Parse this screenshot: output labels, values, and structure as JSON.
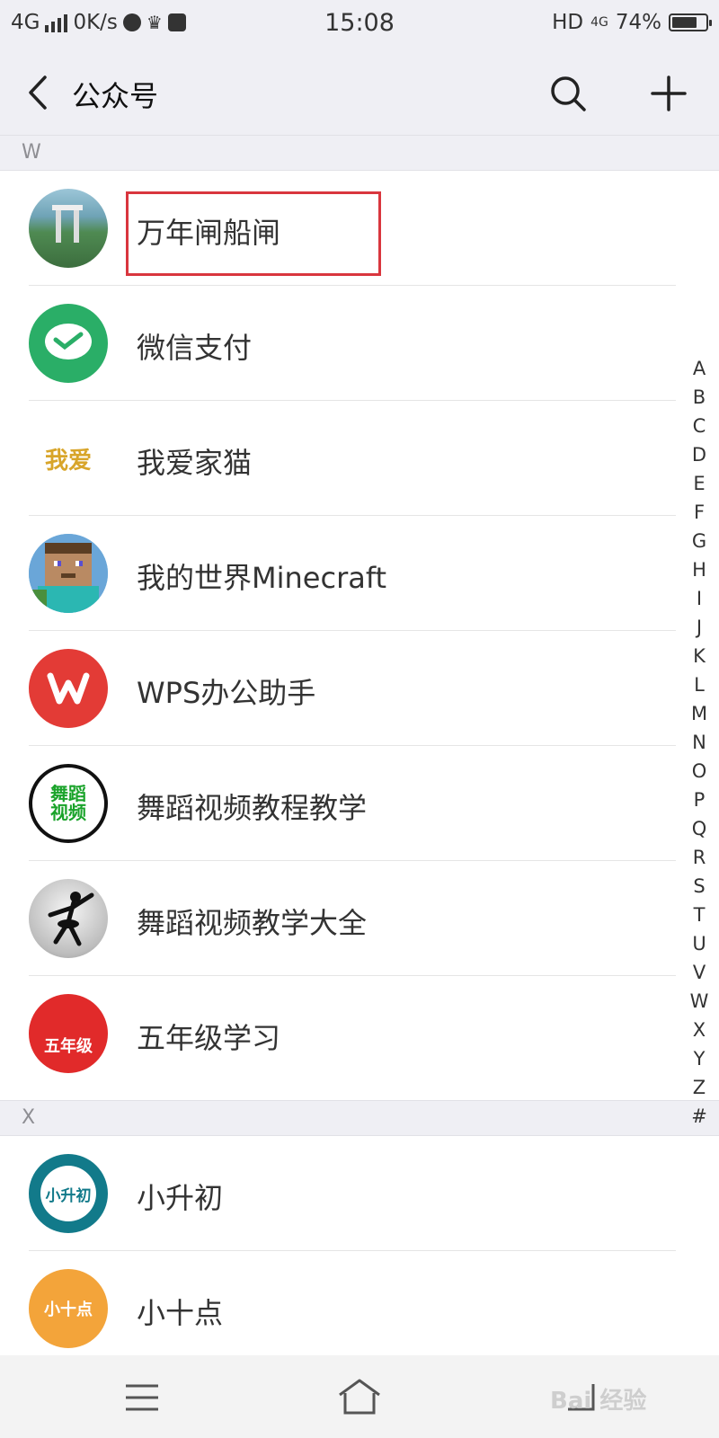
{
  "status_bar": {
    "network": "4G",
    "speed": "0K/s",
    "time": "15:08",
    "hd": "HD",
    "sub_network": "4G",
    "battery": "74%",
    "battery_level": 0.74
  },
  "header": {
    "title": "公众号",
    "icons": [
      "back-icon",
      "search-icon",
      "plus-icon"
    ]
  },
  "sections": [
    {
      "letter": "W",
      "items": [
        {
          "name": "万年闸船闸",
          "avatar": "ship-lock-photo"
        },
        {
          "name": "微信支付",
          "avatar": "wechat-pay-logo"
        },
        {
          "name": "我爱家猫",
          "avatar": "text-logo"
        },
        {
          "name": "我的世界Minecraft",
          "avatar": "minecraft-face"
        },
        {
          "name": "WPS办公助手",
          "avatar": "wps-logo"
        },
        {
          "name": "舞蹈视频教程教学",
          "avatar": "dance-video-text"
        },
        {
          "name": "舞蹈视频教学大全",
          "avatar": "dancer-silhouette"
        },
        {
          "name": "五年级学习",
          "avatar": "grade-five-logo"
        }
      ]
    },
    {
      "letter": "X",
      "items": [
        {
          "name": "小升初",
          "avatar": "xiaoshengchu-logo"
        },
        {
          "name": "小十点",
          "avatar": "xiaoshidian-logo"
        }
      ]
    }
  ],
  "index_letters": [
    "A",
    "B",
    "C",
    "D",
    "E",
    "F",
    "G",
    "H",
    "I",
    "J",
    "K",
    "L",
    "M",
    "N",
    "O",
    "P",
    "Q",
    "R",
    "S",
    "T",
    "U",
    "V",
    "W",
    "X",
    "Y",
    "Z",
    "#"
  ],
  "avatar_text": {
    "woai": "我爱",
    "dance1": "舞蹈",
    "dance2": "视频",
    "grade": "五年级",
    "xsc": "小升初",
    "xsd": "小十点"
  },
  "watermark": "Bai 经验",
  "colors": {
    "highlight_border": "#d9363e",
    "wechat_green": "#2aae67",
    "wps_red": "#e33b36",
    "header_bg": "#efeff4"
  }
}
